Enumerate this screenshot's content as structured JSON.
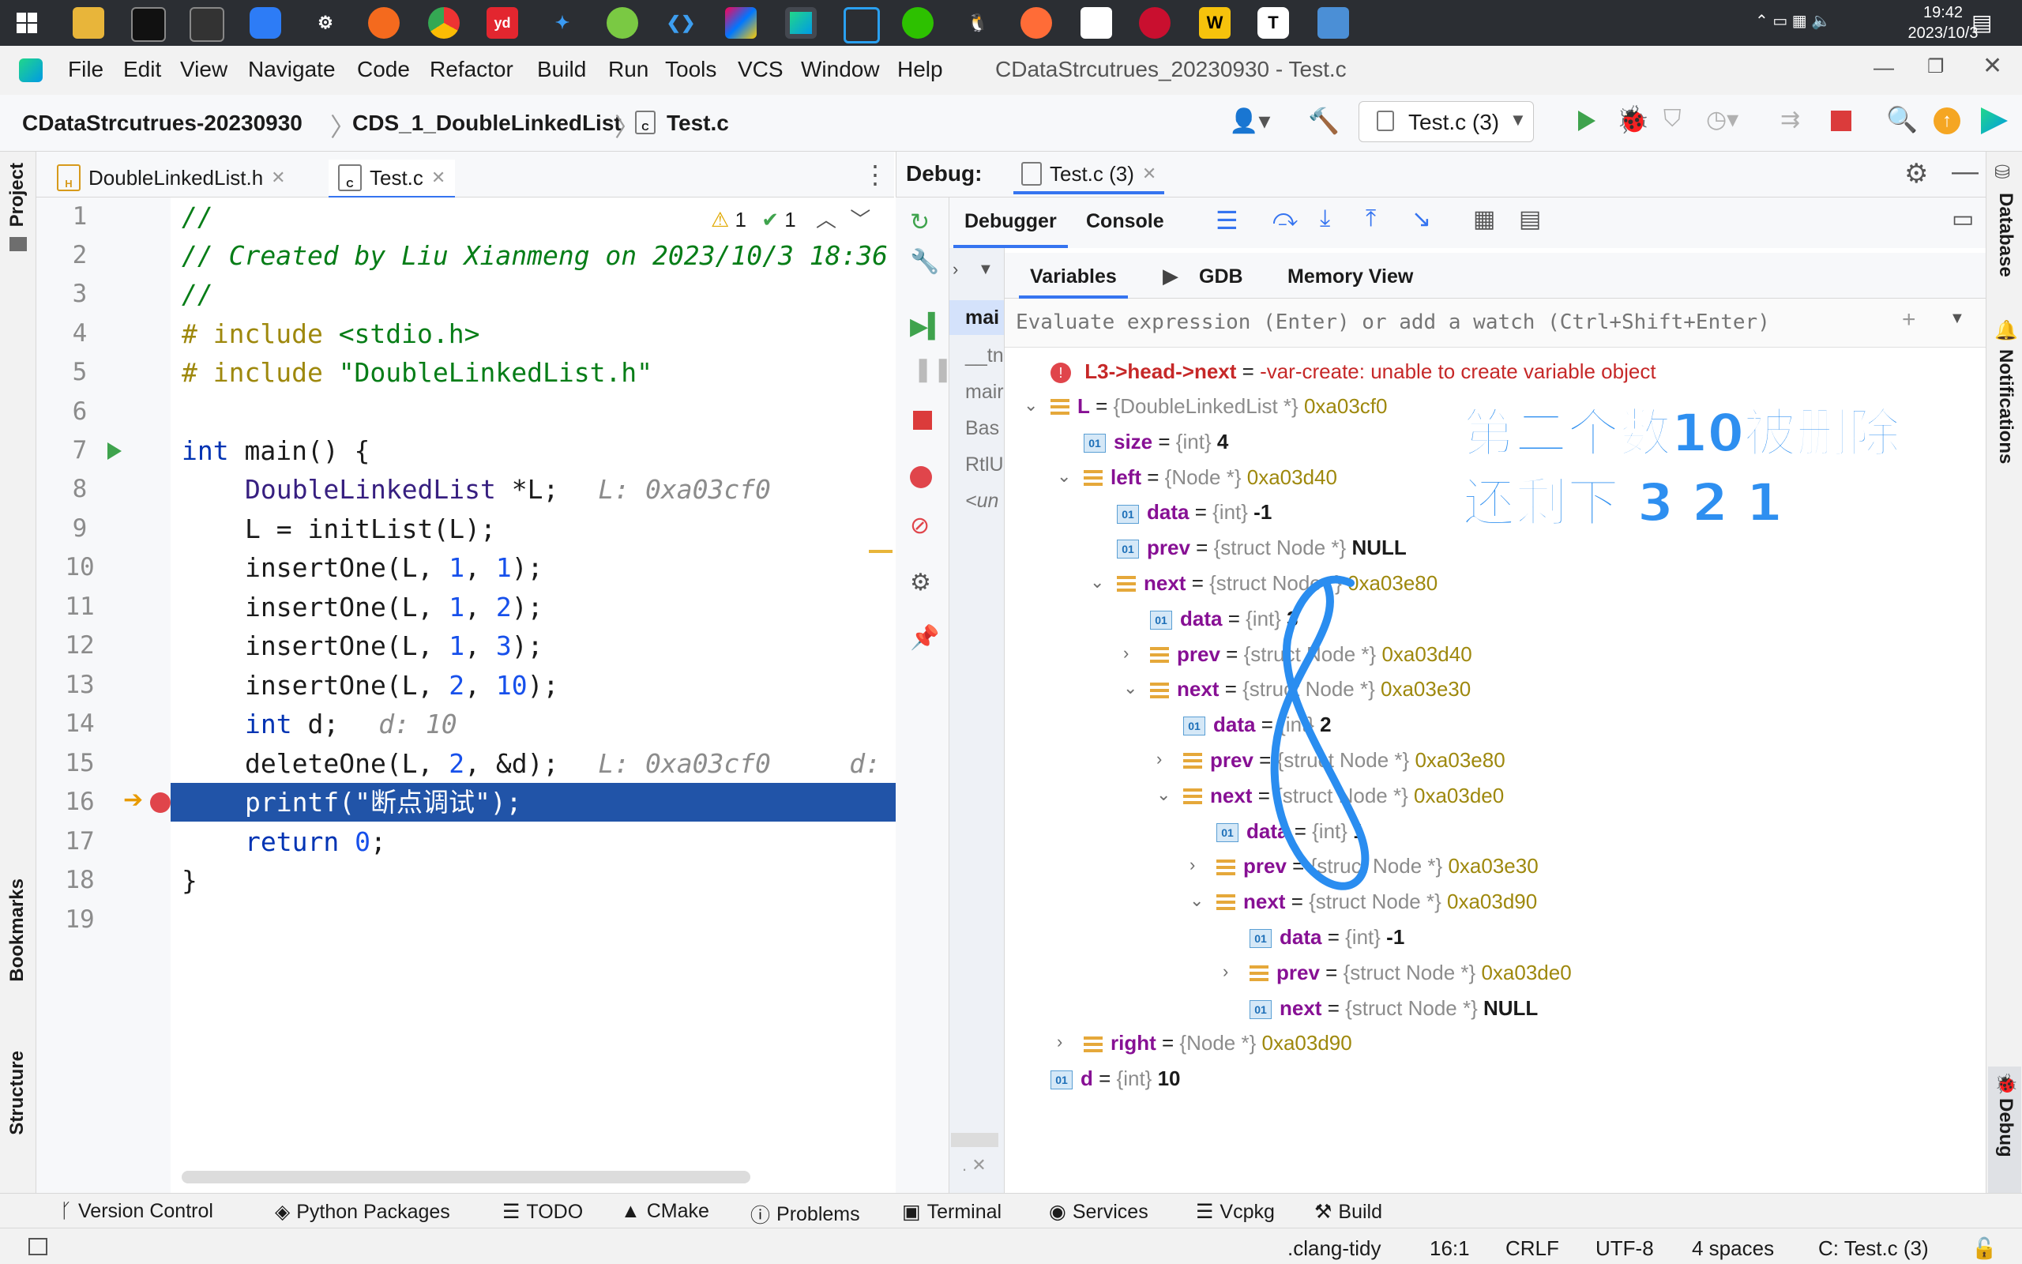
{
  "taskbar": {
    "time": "19:42",
    "date": "2023/10/3",
    "apps": [
      "windows-start",
      "file-explorer",
      "terminal",
      "powershell",
      "bluetooth-app",
      "settings",
      "firefox",
      "chrome",
      "youdao",
      "wps",
      "feishu",
      "vscode",
      "intellij",
      "clion",
      "mockup-tool",
      "wechat",
      "qq",
      "postman",
      "codesandbox",
      "rider",
      "wiz",
      "typora",
      "remote-desktop"
    ]
  },
  "menubar": {
    "items": [
      "File",
      "Edit",
      "View",
      "Navigate",
      "Code",
      "Refactor",
      "Build",
      "Run",
      "Tools",
      "VCS",
      "Window",
      "Help"
    ],
    "window_title": "CDataStrcutrues_20230930 - Test.c"
  },
  "navbar": {
    "crumbs": [
      "CDataStrcutrues-20230930",
      "CDS_1_DoubleLinkedList",
      "Test.c"
    ],
    "run_config": "Test.c (3)"
  },
  "left_strip": {
    "project": "Project",
    "bookmarks": "Bookmarks",
    "structure": "Structure"
  },
  "right_strip": {
    "database": "Database",
    "notifications": "Notifications",
    "debug": "Debug"
  },
  "editor": {
    "tabs": [
      {
        "label": "DoubleLinkedList.h",
        "icon": "H"
      },
      {
        "label": "Test.c",
        "icon": "C"
      }
    ],
    "inspection": {
      "warnings": "1",
      "typos": "1"
    },
    "line_numbers": [
      "1",
      "2",
      "3",
      "4",
      "5",
      "6",
      "7",
      "8",
      "9",
      "10",
      "11",
      "12",
      "13",
      "14",
      "15",
      "16",
      "17",
      "18",
      "19"
    ],
    "lines": {
      "l1": "//",
      "l2": "// Created by Liu Xianmeng on 2023/10/3 18:36",
      "l3": "//",
      "l4a": "# include ",
      "l4b": "<stdio.h>",
      "l5a": "# include ",
      "l5b": "\"DoubleLinkedList.h\"",
      "l7a": "int",
      "l7b": " main() {",
      "l8a": "DoubleLinkedList",
      "l8b": " *L;",
      "l8h": "L: 0xa03cf0",
      "l9": "L = initList(L);",
      "l10": [
        "insertOne(L, ",
        "1",
        ", ",
        "1",
        ");"
      ],
      "l11": [
        "insertOne(L, ",
        "1",
        ", ",
        "2",
        ");"
      ],
      "l12": [
        "insertOne(L, ",
        "1",
        ", ",
        "3",
        ");"
      ],
      "l13": [
        "insertOne(L, ",
        "2",
        ", ",
        "10",
        ");"
      ],
      "l14a": "int",
      "l14b": " d;",
      "l14h": "d: 10",
      "l15a": "deleteOne(L, ",
      "l15n": "2",
      "l15b": ", &d);",
      "l15h": "L: 0xa03cf0     d:",
      "l16": "printf(\"断点调试\");",
      "l17a": "return",
      "l17n": "0",
      "l17b": ";",
      "l18": "}"
    }
  },
  "debug": {
    "label": "Debug:",
    "session_tab": "Test.c (3)",
    "tabs": [
      "Debugger",
      "Console"
    ],
    "var_tabs": [
      "Variables",
      "GDB",
      "Memory View"
    ],
    "frames": [
      "mai",
      "__tn",
      "mair",
      "Bas",
      "RtlU",
      "<un"
    ],
    "eval_placeholder": "Evaluate expression (Enter) or add a watch (Ctrl+Shift+Enter)",
    "error": {
      "name": "L3->head->next",
      "msg": "-var-create: unable to create variable object"
    },
    "rows": [
      {
        "name": "L",
        "type": "{DoubleLinkedList *}",
        "value": "0xa03cf0"
      },
      {
        "name": "size",
        "type": "{int}",
        "value": "4"
      },
      {
        "name": "left",
        "type": "{Node *}",
        "value": "0xa03d40"
      },
      {
        "name": "data",
        "type": "{int}",
        "value": "-1"
      },
      {
        "name": "prev",
        "type": "{struct Node *}",
        "value": "NULL"
      },
      {
        "name": "next",
        "type": "{struct Node *}",
        "value": "0xa03e80"
      },
      {
        "name": "data",
        "type": "{int}",
        "value": "3"
      },
      {
        "name": "prev",
        "type": "{struct Node *}",
        "value": "0xa03d40"
      },
      {
        "name": "next",
        "type": "{struct Node *}",
        "value": "0xa03e30"
      },
      {
        "name": "data",
        "type": "{int}",
        "value": "2"
      },
      {
        "name": "prev",
        "type": "{struct Node *}",
        "value": "0xa03e80"
      },
      {
        "name": "next",
        "type": "{struct Node *}",
        "value": "0xa03de0"
      },
      {
        "name": "data",
        "type": "{int}",
        "value": "1"
      },
      {
        "name": "prev",
        "type": "{struct Node *}",
        "value": "0xa03e30"
      },
      {
        "name": "next",
        "type": "{struct Node *}",
        "value": "0xa03d90"
      },
      {
        "name": "data",
        "type": "{int}",
        "value": "-1"
      },
      {
        "name": "prev",
        "type": "{struct Node *}",
        "value": "0xa03de0"
      },
      {
        "name": "next",
        "type": "{struct Node *}",
        "value": "NULL"
      },
      {
        "name": "right",
        "type": "{Node *}",
        "value": "0xa03d90"
      },
      {
        "name": "d",
        "type": "{int}",
        "value": "10"
      }
    ],
    "eq": "="
  },
  "annotation": {
    "line1": "第二个数10被删除",
    "line2": "还剩下 3 2 1",
    "color": "#2e8ff0"
  },
  "tool_windows": [
    "Version Control",
    "Python Packages",
    "TODO",
    "CMake",
    "Problems",
    "Terminal",
    "Services",
    "Vcpkg",
    "Build"
  ],
  "status": {
    "clang_tidy": ".clang-tidy",
    "position": "16:1",
    "line_sep": "CRLF",
    "encoding": "UTF-8",
    "indent": "4 spaces",
    "context": "C: Test.c (3)"
  }
}
